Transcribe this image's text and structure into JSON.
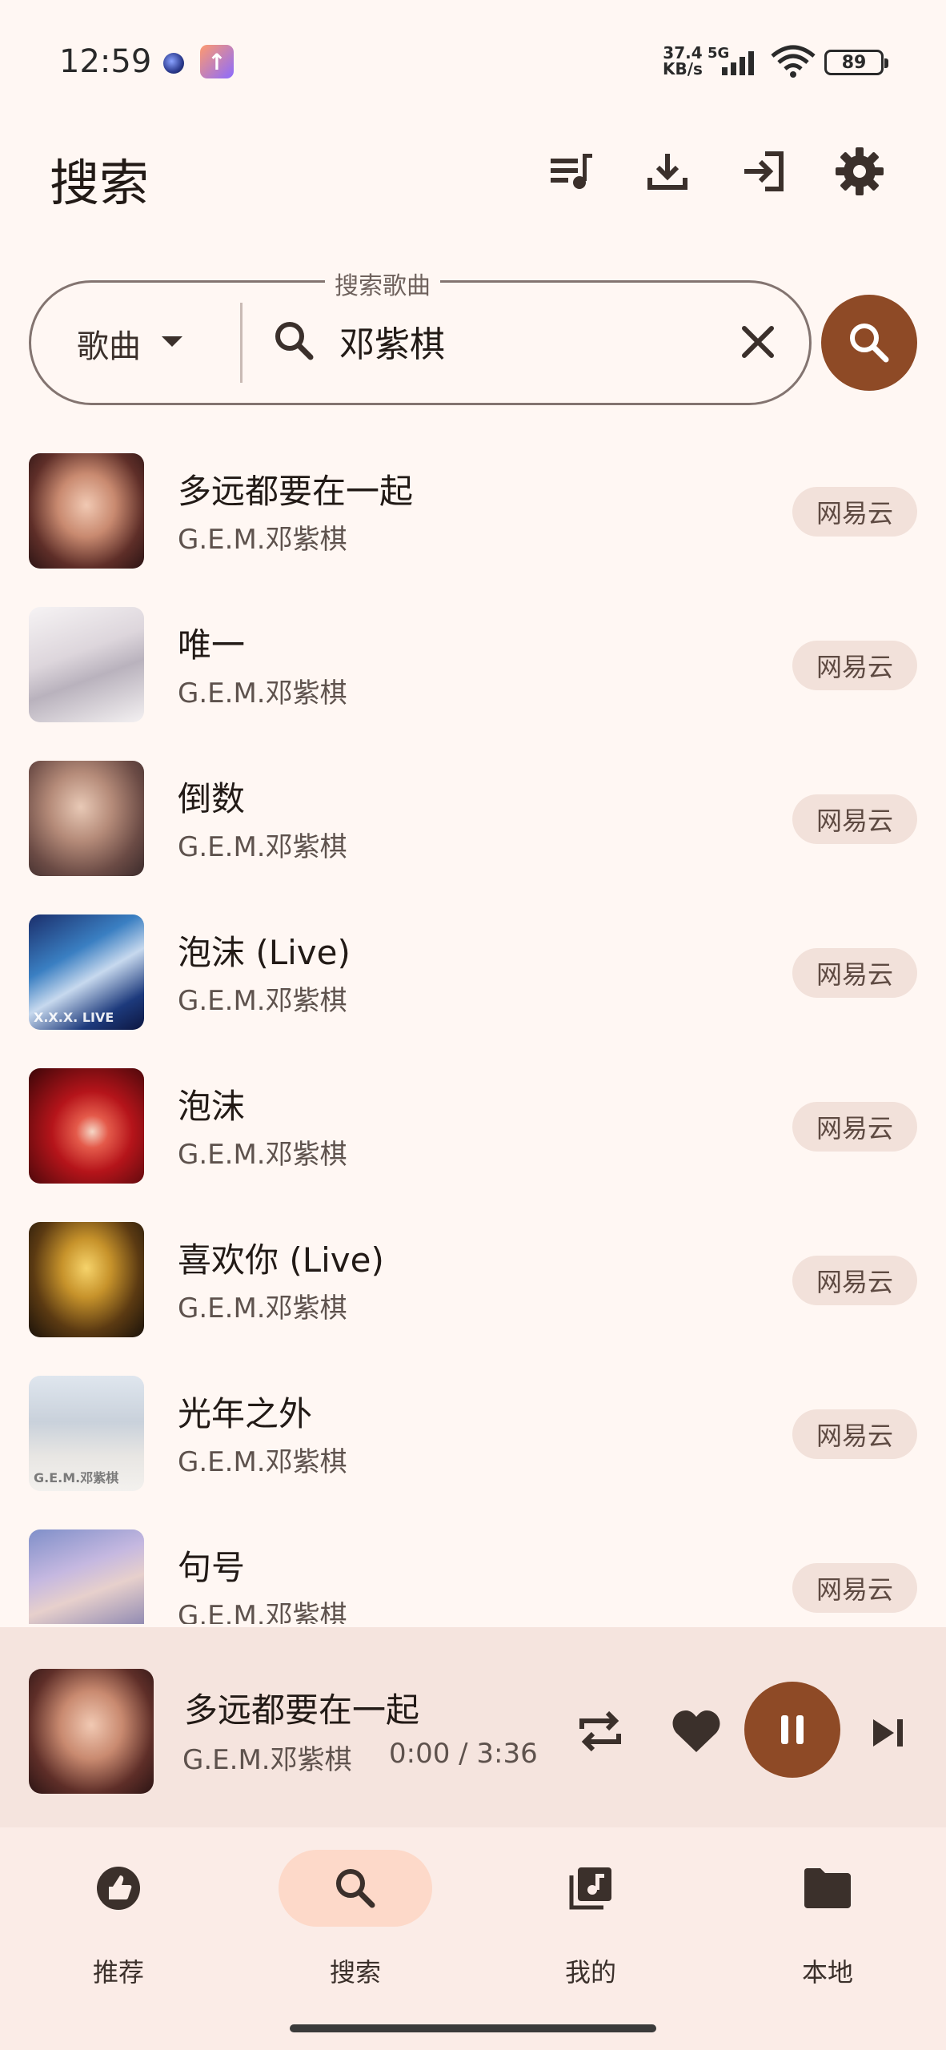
{
  "status_bar": {
    "time": "12:59",
    "net_speed_value": "37.4",
    "net_speed_unit": "KB/s",
    "network": "5G",
    "battery": "89"
  },
  "header": {
    "title": "搜索",
    "icons": [
      "queue-music-icon",
      "download-icon",
      "login-icon",
      "gear-icon"
    ]
  },
  "search": {
    "legend": "搜索歌曲",
    "type_label": "歌曲",
    "query": "邓紫棋"
  },
  "results": [
    {
      "title": "多远都要在一起",
      "artist": "G.E.M.邓紫棋",
      "source": "网易云"
    },
    {
      "title": "唯一",
      "artist": "G.E.M.邓紫棋",
      "source": "网易云"
    },
    {
      "title": "倒数",
      "artist": "G.E.M.邓紫棋",
      "source": "网易云"
    },
    {
      "title": "泡沫 (Live)",
      "artist": "G.E.M.邓紫棋",
      "source": "网易云"
    },
    {
      "title": "泡沫",
      "artist": "G.E.M.邓紫棋",
      "source": "网易云"
    },
    {
      "title": "喜欢你 (Live)",
      "artist": "G.E.M.邓紫棋",
      "source": "网易云"
    },
    {
      "title": "光年之外",
      "artist": "G.E.M.邓紫棋",
      "source": "网易云"
    },
    {
      "title": "句号",
      "artist": "G.E.M.邓紫棋",
      "source": "网易云"
    }
  ],
  "covers": {
    "r3": "X.X.X. LIVE",
    "r6": "G.E.M.邓紫棋"
  },
  "player": {
    "title": "多远都要在一起",
    "artist": "G.E.M.邓紫棋",
    "time": "0:00  /  3:36"
  },
  "nav": {
    "items": [
      {
        "label": "推荐",
        "icon": "thumb-up-icon"
      },
      {
        "label": "搜索",
        "icon": "search-icon",
        "active": true
      },
      {
        "label": "我的",
        "icon": "library-music-icon"
      },
      {
        "label": "本地",
        "icon": "folder-icon"
      }
    ]
  },
  "colors": {
    "accent": "#8E4A26",
    "background": "#FFF7F3",
    "chip": "#F2E1DA",
    "nav_active": "#FDD9C9"
  }
}
